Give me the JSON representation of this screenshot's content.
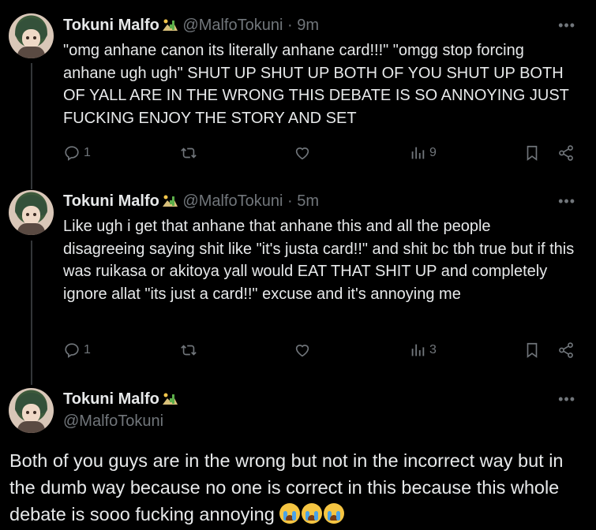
{
  "tweets": [
    {
      "name": "Tokuni Malfo",
      "handle": "@MalfoTokuni",
      "time": "· 9m",
      "text": "\"omg anhane canon its literally anhane card!!!\" \"omgg stop forcing anhane ugh ugh\" SHUT UP SHUT UP BOTH OF YOU SHUT UP BOTH OF YALL ARE IN THE WRONG THIS DEBATE IS SO ANNOYING JUST FUCKING ENJOY THE STORY AND SET",
      "replies": "1",
      "views": "9"
    },
    {
      "name": "Tokuni Malfo",
      "handle": "@MalfoTokuni",
      "time": "· 5m",
      "text": "Like ugh i get that anhane that anhane this and all the people disagreeing saying shit like \"it's justa card!!\" and shit bc tbh true but if this was ruikasa or akitoya yall would EAT THAT SHIT UP and completely ignore allat \"its just a card!!\" excuse and it's annoying me",
      "replies": "1",
      "views": "3"
    }
  ],
  "main": {
    "name": "Tokuni Malfo",
    "handle": "@MalfoTokuni",
    "text": "Both of you guys are in the wrong but not in the incorrect way but in the dumb way because no one is correct in this because this whole debate is sooo fucking annoying",
    "emoji_count": 3
  },
  "more_label": "•••",
  "colors": {
    "background": "#000000",
    "text": "#e7e9ea",
    "muted": "#71767b",
    "thread": "#333639"
  }
}
